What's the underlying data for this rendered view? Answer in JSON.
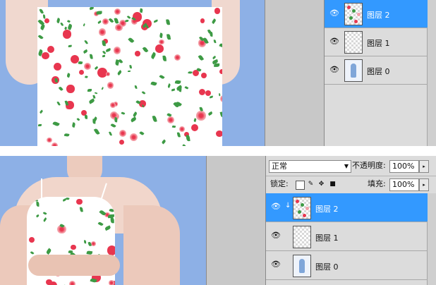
{
  "top_panel": {
    "layers": [
      {
        "name": "图层 2",
        "selected": true,
        "thumb": "pattern"
      },
      {
        "name": "图层 1",
        "selected": false,
        "thumb": "transparent"
      },
      {
        "name": "图层 0",
        "selected": false,
        "thumb": "photo"
      }
    ]
  },
  "bottom_panel": {
    "blend_mode": "正常",
    "opacity_label": "不透明度:",
    "opacity_value": "100%",
    "lock_label": "锁定:",
    "fill_label": "填充:",
    "fill_value": "100%",
    "lock_icons": [
      "lock-transparency-icon",
      "lock-pixels-icon",
      "lock-position-icon",
      "lock-all-icon"
    ],
    "layers": [
      {
        "name": "图层 2",
        "selected": true,
        "thumb": "pattern",
        "clipped": true
      },
      {
        "name": "图层 1",
        "selected": false,
        "thumb": "transparent",
        "clipped": false
      },
      {
        "name": "图层 0",
        "selected": false,
        "thumb": "photo",
        "clipped": false
      }
    ]
  },
  "colors": {
    "canvas_bg": "#8db0e6",
    "selected_row": "#3399ff",
    "panel_bg": "#dcdcdc",
    "flower_red": "#e8364f",
    "flower_pink": "#f4a0a8",
    "leaf_green": "#3d9a44"
  }
}
